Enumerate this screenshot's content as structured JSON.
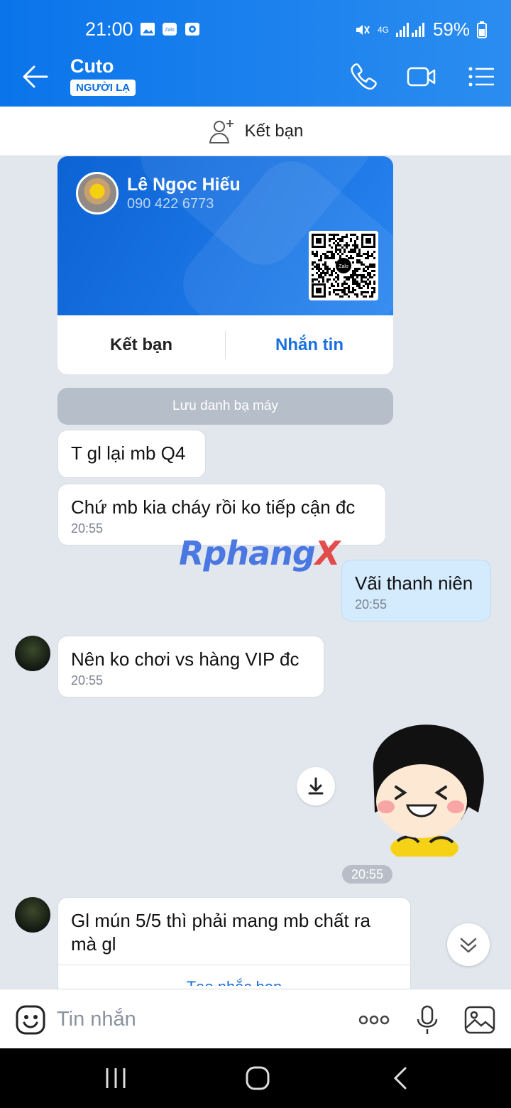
{
  "status_bar": {
    "time": "21:00",
    "network": "4G",
    "battery": "59%"
  },
  "header": {
    "title": "Cuto",
    "badge": "NGƯỜI LẠ"
  },
  "add_friend_bar": {
    "label": "Kết bạn"
  },
  "contact_card": {
    "name": "Lê Ngọc Hiếu",
    "phone": "090 422 6773",
    "qr_logo": "Zalo",
    "add_friend_label": "Kết bạn",
    "message_label": "Nhắn tin"
  },
  "save_contact": {
    "label": "Lưu danh bạ máy"
  },
  "messages": [
    {
      "text": "T gl lại mb Q4",
      "time": ""
    },
    {
      "text": "Chứ mb kia cháy rồi ko tiếp cận đc",
      "time": "20:55"
    },
    {
      "text": "Vãi thanh niên",
      "time": "20:55"
    },
    {
      "text": "Nên ko chơi vs hàng VIP đc",
      "time": "20:55"
    },
    {
      "text": "Gl mún 5/5 thì phải mang mb chất ra mà gl",
      "action": "Tạo nhắc hẹn"
    }
  ],
  "sticker_time": "20:55",
  "watermark": {
    "part1": "Rphang",
    "part2": "X"
  },
  "composer": {
    "placeholder": "Tin nhắn"
  },
  "colors": {
    "header": "#0a74ea",
    "accent": "#1a6fe0",
    "mine_bubble": "#d4eafd"
  }
}
